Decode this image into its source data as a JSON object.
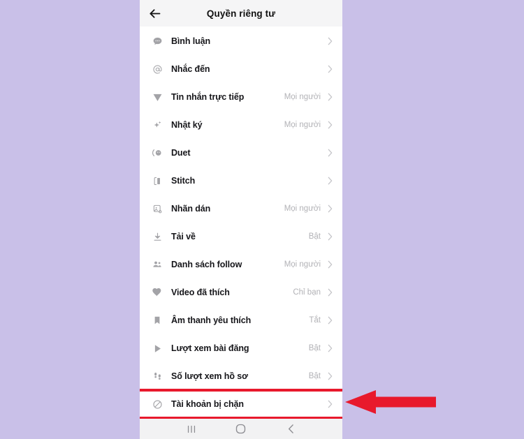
{
  "app": {
    "screen_title": "Quyền riêng tư",
    "accent_color": "#e8192c",
    "page_background": "#c9c0e8",
    "panel_background": "#ffffff",
    "header_background": "#f5f5f6"
  },
  "header": {
    "title": "Quyền riêng tư",
    "back_icon": "back-arrow-icon"
  },
  "settings": {
    "rows": [
      {
        "icon": "comment-bubble-icon",
        "label": "Bình luận",
        "value": ""
      },
      {
        "icon": "mention-at-icon",
        "label": "Nhắc đến",
        "value": ""
      },
      {
        "icon": "send-plane-icon",
        "label": "Tin nhắn trực tiếp",
        "value": "Mọi người"
      },
      {
        "icon": "sparkle-icon",
        "label": "Nhật ký",
        "value": "Mọi người"
      },
      {
        "icon": "duet-icon",
        "label": "Duet",
        "value": ""
      },
      {
        "icon": "stitch-icon",
        "label": "Stitch",
        "value": ""
      },
      {
        "icon": "sticker-icon",
        "label": "Nhãn dán",
        "value": "Mọi người"
      },
      {
        "icon": "download-icon",
        "label": "Tải về",
        "value": "Bật"
      },
      {
        "icon": "people-group-icon",
        "label": "Danh sách follow",
        "value": "Mọi người"
      },
      {
        "icon": "heart-icon",
        "label": "Video đã thích",
        "value": "Chỉ bạn"
      },
      {
        "icon": "bookmark-icon",
        "label": "Âm thanh yêu thích",
        "value": "Tắt"
      },
      {
        "icon": "play-icon",
        "label": "Lượt xem bài đăng",
        "value": "Bật"
      },
      {
        "icon": "footprints-icon",
        "label": "Số lượt xem hồ sơ",
        "value": "Bật"
      },
      {
        "icon": "block-circle-icon",
        "label": "Tài khoản bị chặn",
        "value": "",
        "highlighted": true
      }
    ],
    "chevron_icon": "chevron-right-icon"
  },
  "navbar": {
    "recents_label": "|||",
    "home_label": "○",
    "back_label": "‹",
    "items": [
      {
        "icon": "recents-icon"
      },
      {
        "icon": "home-circle-icon"
      },
      {
        "icon": "back-chevron-icon"
      }
    ]
  },
  "annotation": {
    "arrow_icon": "left-pointing-arrow-icon",
    "arrow_color": "#e8192c",
    "highlight_target": "Tài khoản bị chặn"
  }
}
